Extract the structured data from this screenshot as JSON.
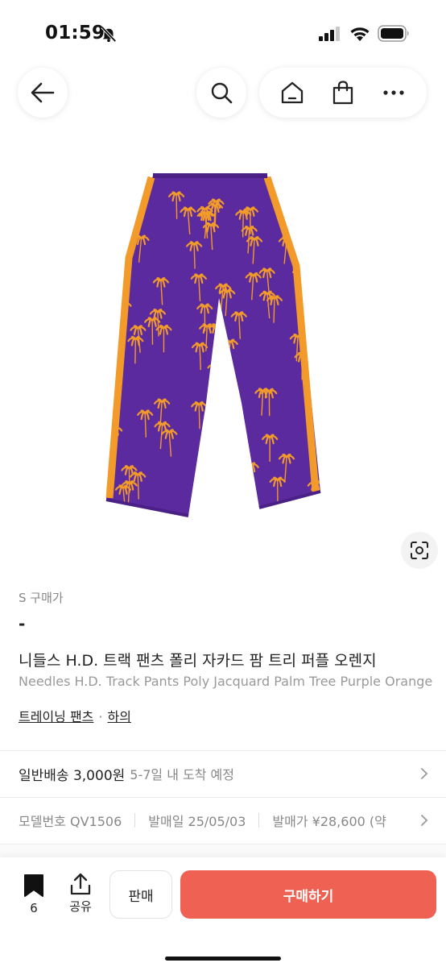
{
  "status_bar": {
    "time": "01:59"
  },
  "product": {
    "size_label": "S 구매가",
    "price": "-",
    "title_ko": "니들스 H.D. 트랙 팬츠 폴리 자카드 팜 트리 퍼플 오렌지",
    "title_en": "Needles H.D. Track Pants Poly Jacquard Palm Tree Purple Orange",
    "category": {
      "primary": "트레이닝 팬츠",
      "separator": "·",
      "secondary": "하의"
    },
    "colors": {
      "purple": "#5a2a9e",
      "orange": "#f29a2a"
    }
  },
  "shipping": {
    "label": "일반배송 3,000원",
    "eta": "5-7일 내 도착 예정"
  },
  "meta": {
    "model": {
      "label": "모델번호",
      "value": "QV1506"
    },
    "release_date": {
      "label": "발매일",
      "value": "25/05/03"
    },
    "release_price": {
      "label": "발매가",
      "value": "¥28,600 (약"
    }
  },
  "bottom_bar": {
    "wish_count": "6",
    "share_label": "공유",
    "sell_label": "판매",
    "buy_label": "구매하기"
  },
  "theme": {
    "accent": "#ef6253"
  },
  "icons": [
    "back-arrow-icon",
    "search-icon",
    "home-icon",
    "shopping-bag-icon",
    "more-icon",
    "lens-icon",
    "bookmark-icon",
    "share-icon",
    "chevron-right-icon",
    "bell-slash-icon"
  ]
}
